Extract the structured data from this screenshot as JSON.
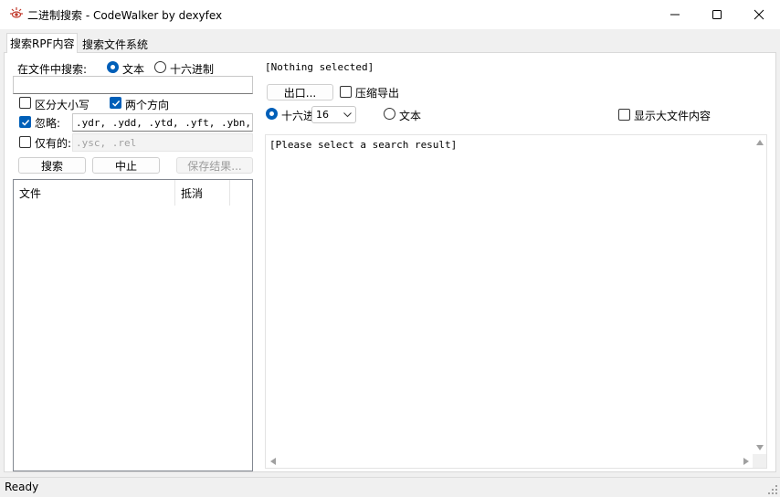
{
  "window": {
    "title": "二进制搜索 - CodeWalker by dexyfex"
  },
  "tabs": [
    {
      "label": "搜索RPF内容"
    },
    {
      "label": "搜索文件系统"
    }
  ],
  "search": {
    "in_file_label": "在文件中搜索:",
    "mode_text_label": "文本",
    "mode_hex_label": "十六进制",
    "query_value": "",
    "case_sensitive_label": "区分大小写",
    "both_directions_label": "两个方向",
    "ignore_label": "忽略:",
    "ignore_value": ".ydr, .ydd, .ytd, .yft, .ybn, .ycd, .awc, .bik",
    "only_label": "仅有的:",
    "only_placeholder": ".ysc, .rel",
    "search_button": "搜索",
    "stop_button": "中止",
    "save_button": "保存结果..."
  },
  "results": {
    "columns": [
      "文件",
      "抵消"
    ]
  },
  "preview": {
    "selection_text": "[Nothing selected]",
    "export_button": "出口...",
    "compress_export_label": "压缩导出",
    "view_hex_label": "十六进",
    "hex_width_value": "16",
    "view_text_label": "文本",
    "show_large_label": "显示大文件内容",
    "content_text": "[Please select a search result]"
  },
  "status": {
    "text": "Ready"
  },
  "colors": {
    "accent": "#005fb8",
    "icon_red": "#c0392b"
  }
}
